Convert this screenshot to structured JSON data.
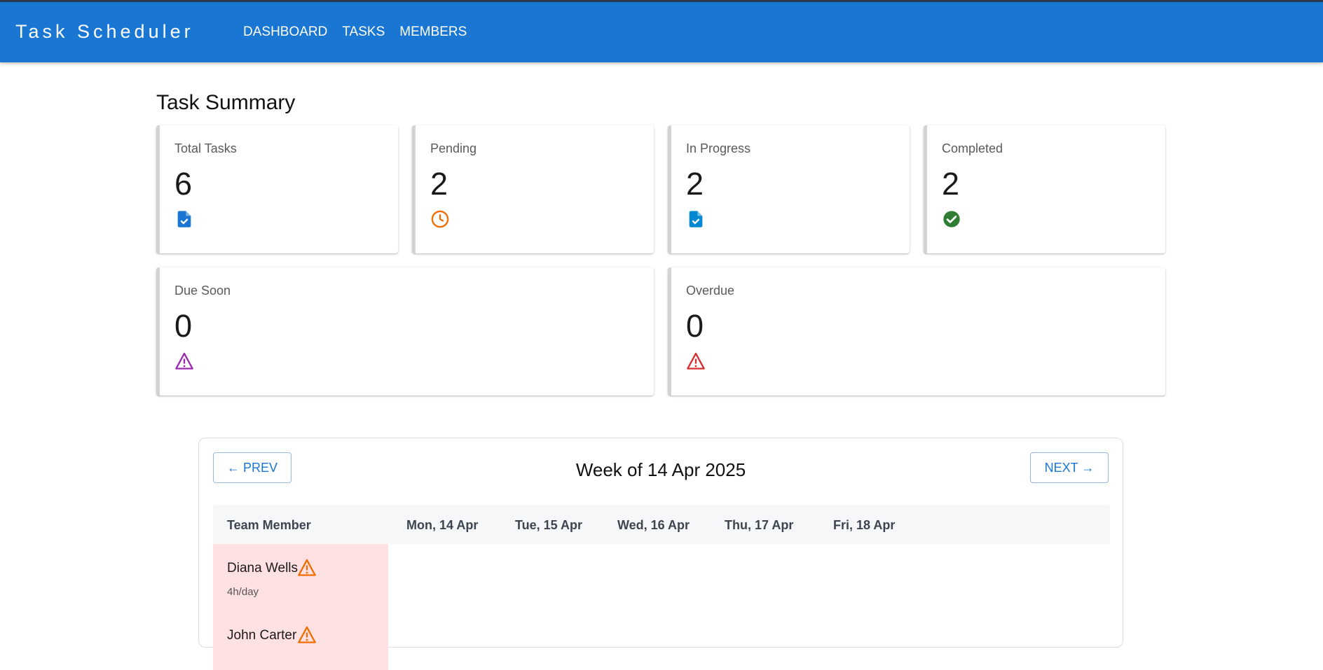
{
  "app": {
    "title": "Task Scheduler",
    "nav": [
      "DASHBOARD",
      "TASKS",
      "MEMBERS"
    ]
  },
  "summary": {
    "title": "Task Summary",
    "cards": [
      {
        "label": "Total Tasks",
        "value": "6",
        "icon": "task-document-icon",
        "color": "#1976d2"
      },
      {
        "label": "Pending",
        "value": "2",
        "icon": "clock-icon",
        "color": "#ef6c00"
      },
      {
        "label": "In Progress",
        "value": "2",
        "icon": "task-document-icon",
        "color": "#0288d1"
      },
      {
        "label": "Completed",
        "value": "2",
        "icon": "check-circle-icon",
        "color": "#2e7d32"
      },
      {
        "label": "Due Soon",
        "value": "0",
        "icon": "warning-icon",
        "color": "#9c27b0"
      },
      {
        "label": "Overdue",
        "value": "0",
        "icon": "warning-icon",
        "color": "#d32f2f"
      }
    ]
  },
  "week": {
    "prev_label": "← PREV",
    "next_label": "NEXT →",
    "title": "Week of 14 Apr 2025",
    "columns": [
      "Team Member",
      "Mon, 14 Apr",
      "Tue, 15 Apr",
      "Wed, 16 Apr",
      "Thu, 17 Apr",
      "Fri, 18 Apr"
    ],
    "members": [
      {
        "name": "Diana Wells",
        "hours": "4h/day",
        "icon": "warning-icon",
        "color": "#ef6c00"
      },
      {
        "name": "John Carter",
        "hours": "",
        "icon": "warning-icon",
        "color": "#ef6c00"
      }
    ]
  },
  "colors": {
    "appbar": "#1976d2",
    "member_highlight": "#ffe0e3"
  }
}
